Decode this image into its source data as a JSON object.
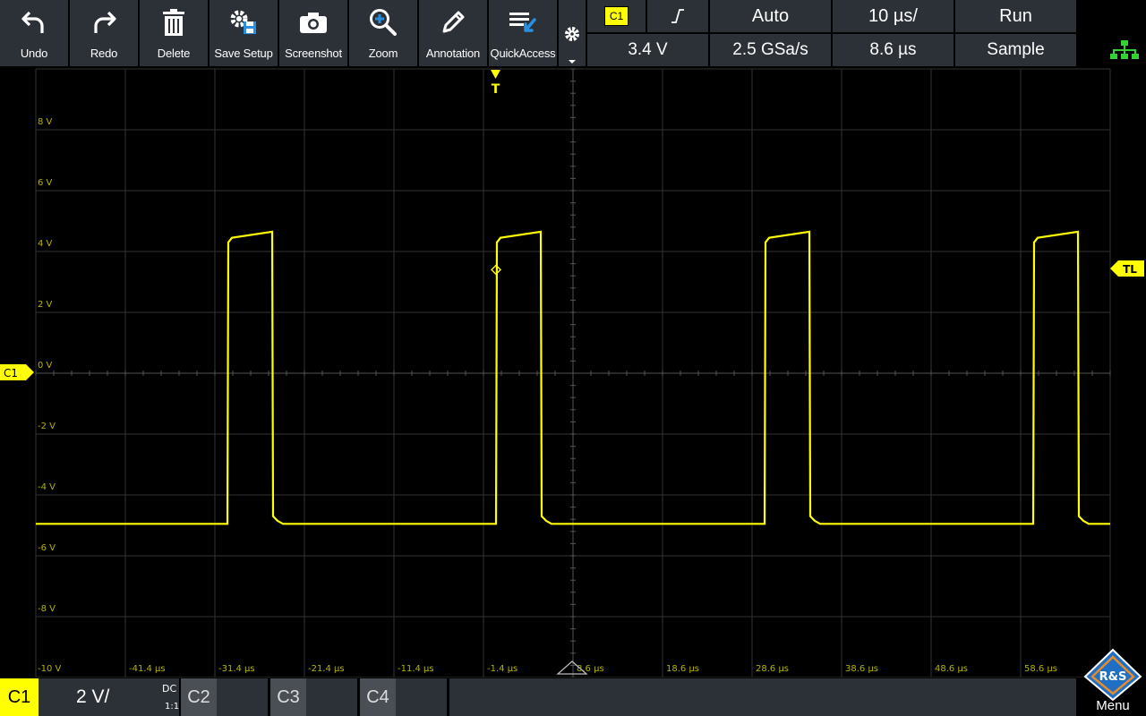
{
  "toolbar": {
    "buttons": [
      {
        "label": "Undo",
        "icon": "undo-icon"
      },
      {
        "label": "Redo",
        "icon": "redo-icon"
      },
      {
        "label": "Delete",
        "icon": "trash-icon"
      },
      {
        "label": "Save Setup",
        "icon": "save-setup-icon"
      },
      {
        "label": "Screenshot",
        "icon": "camera-icon"
      },
      {
        "label": "Zoom",
        "icon": "zoom-icon"
      },
      {
        "label": "Annotation",
        "icon": "pen-icon"
      },
      {
        "label": "QuickAccess",
        "icon": "quickaccess-icon"
      }
    ],
    "gear_icon": "gear-icon"
  },
  "status": {
    "trigger_source": "C1",
    "trigger_slope": "╰╯",
    "trigger_mode": "Auto",
    "timebase": "10 µs/",
    "run_state": "Run",
    "trigger_level": "3.4 V",
    "sample_rate": "2.5 GSa/s",
    "trigger_position": "8.6 µs",
    "acquisition_mode": "Sample",
    "network_icon": "network-icon"
  },
  "graticule": {
    "y_labels": [
      "8 V",
      "6 V",
      "4 V",
      "2 V",
      "0 V",
      "-2 V",
      "-4 V",
      "-6 V",
      "-8 V",
      "-10 V"
    ],
    "x_labels": [
      "-41.4 µs",
      "-31.4 µs",
      "-21.4 µs",
      "-11.4 µs",
      "-1.4 µs",
      "8.6 µs",
      "18.6 µs",
      "28.6 µs",
      "38.6 µs",
      "48.6 µs",
      "58.6 µs"
    ],
    "trigger_marker": "T",
    "trigger_level_marker": "TL",
    "channel_marker": "C1"
  },
  "chart_data": {
    "type": "line",
    "x_unit": "µs",
    "y_unit": "V",
    "xlim": [
      -51.4,
      68.6
    ],
    "ylim": [
      -10,
      10
    ],
    "series": [
      {
        "color": "#ffff00",
        "x": [
          -51.4,
          -30.0,
          -29.9,
          -29.5,
          -25.0,
          -24.9,
          -24.4,
          -23.8,
          -21.4,
          -0.0,
          0.1,
          0.5,
          5.0,
          5.1,
          5.6,
          6.2,
          8.6,
          30.0,
          30.1,
          30.5,
          35.0,
          35.1,
          35.6,
          36.2,
          38.6,
          60.0,
          60.1,
          60.5,
          65.0,
          65.1,
          65.6,
          66.2,
          68.6
        ],
        "y": [
          -4.95,
          -4.95,
          4.3,
          4.45,
          4.65,
          -4.7,
          -4.85,
          -4.95,
          -4.95,
          -4.95,
          4.3,
          4.45,
          4.65,
          -4.7,
          -4.85,
          -4.95,
          -4.95,
          -4.95,
          4.3,
          4.45,
          4.65,
          -4.7,
          -4.85,
          -4.95,
          -4.95,
          -4.95,
          4.3,
          4.45,
          4.65,
          -4.7,
          -4.85,
          -4.95,
          -4.95
        ]
      }
    ],
    "trigger": {
      "x": 0,
      "y": 3.4
    },
    "grid": true
  },
  "bottom": {
    "channels": [
      {
        "label": "C1",
        "scale": "2 V/",
        "coupling": "DC",
        "probe": "1:1",
        "active": true
      },
      {
        "label": "C2",
        "active": false
      },
      {
        "label": "C3",
        "active": false
      },
      {
        "label": "C4",
        "active": false
      }
    ],
    "menu_label": "Menu",
    "logo_text": "R&S"
  },
  "colors": {
    "channel1": "#ffff00",
    "panel": "#2c3137",
    "grid": "#3a3a3a",
    "menu_blue": "#1f6fc4",
    "network": "#35d235"
  }
}
